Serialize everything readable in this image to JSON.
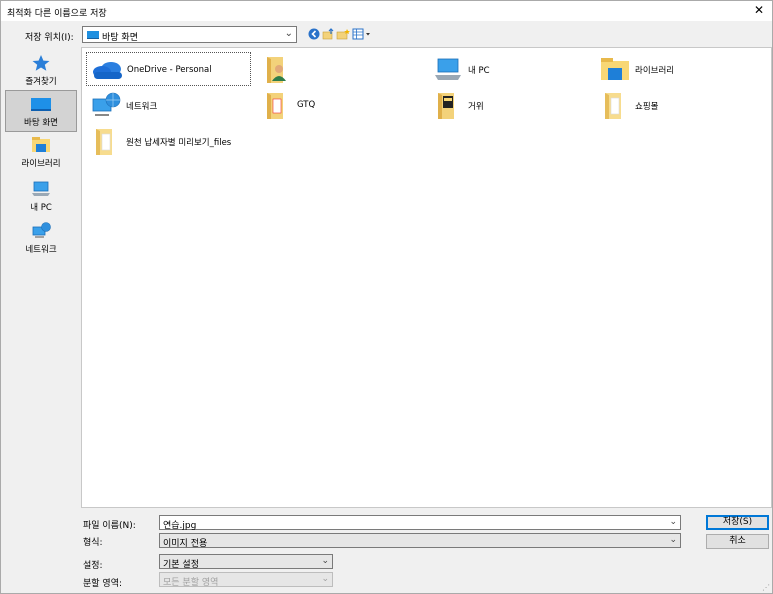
{
  "window": {
    "title": "최적화 다른 이름으로 저장",
    "close_label": "✕"
  },
  "location": {
    "label": "저장 위치(I):",
    "value": "바탕 화면"
  },
  "places": [
    {
      "label": "즐겨찾기"
    },
    {
      "label": "바탕 화면"
    },
    {
      "label": "라이브러리"
    },
    {
      "label": "내 PC"
    },
    {
      "label": "네트워크"
    }
  ],
  "files": [
    {
      "name": "OneDrive - Personal"
    },
    {
      "name": ""
    },
    {
      "name": "내 PC"
    },
    {
      "name": "라이브러리"
    },
    {
      "name": "네트워크"
    },
    {
      "name": "GTQ"
    },
    {
      "name": "거위"
    },
    {
      "name": "쇼핑몰"
    },
    {
      "name": "원천 납세자별 미리보기_files"
    }
  ],
  "bottom": {
    "filename_label": "파일 이름(N):",
    "filename_value": "연습.jpg",
    "format_label": "형식:",
    "format_value": "이미지 전용",
    "settings_label": "설정:",
    "settings_value": "기본 설정",
    "slice_label": "분할 영역:",
    "slice_value": "모든 분할 영역",
    "save_button": "저장(S)",
    "cancel_button": "취소"
  },
  "colors": {
    "accent": "#0078d7",
    "folder": "#f8d775",
    "onedrive": "#1e73d8"
  }
}
